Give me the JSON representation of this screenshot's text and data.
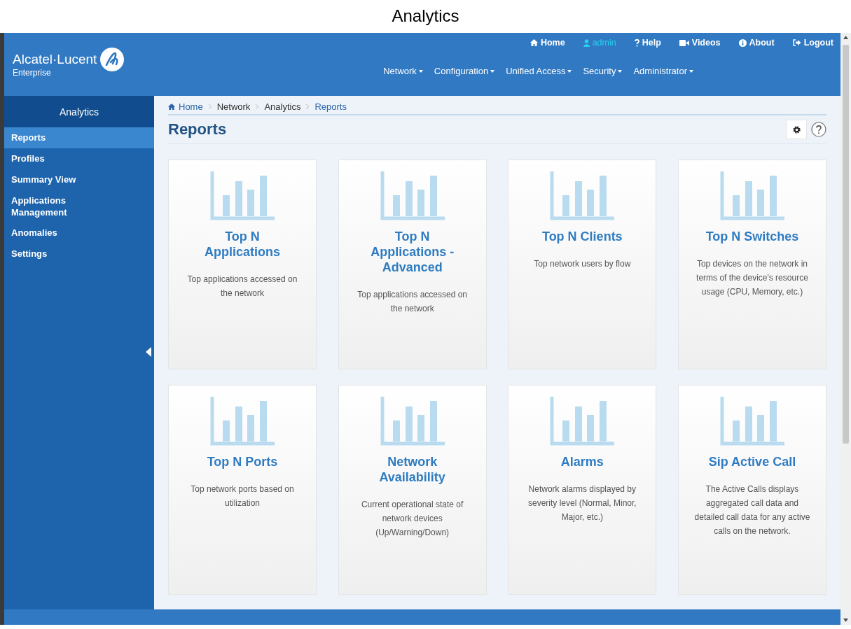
{
  "caption": "Analytics",
  "brand": {
    "name": "Alcatel·Lucent",
    "sub": "Enterprise"
  },
  "top_links": [
    {
      "label": "Home",
      "kind": "home"
    },
    {
      "label": "admin",
      "kind": "user"
    },
    {
      "label": "Help",
      "kind": "help"
    },
    {
      "label": "Videos",
      "kind": "video"
    },
    {
      "label": "About",
      "kind": "info"
    },
    {
      "label": "Logout",
      "kind": "logout"
    }
  ],
  "main_menu": [
    "Network",
    "Configuration",
    "Unified Access",
    "Security",
    "Administrator"
  ],
  "sidebar": {
    "title": "Analytics",
    "items": [
      {
        "label": "Reports",
        "selected": true
      },
      {
        "label": "Profiles",
        "selected": false
      },
      {
        "label": "Summary View",
        "selected": false
      },
      {
        "label": "Applications Management",
        "selected": false
      },
      {
        "label": "Anomalies",
        "selected": false
      },
      {
        "label": "Settings",
        "selected": false
      }
    ]
  },
  "breadcrumb": [
    "Home",
    "Network",
    "Analytics",
    "Reports"
  ],
  "page_title": "Reports",
  "cards": [
    {
      "title": "Top N Applications",
      "description": "Top applications accessed on the network"
    },
    {
      "title": "Top N Applications - Advanced",
      "description": "Top applications accessed on the network"
    },
    {
      "title": "Top N Clients",
      "description": "Top network users by flow"
    },
    {
      "title": "Top N Switches",
      "description": "Top devices on the network in terms of the device's resource usage (CPU, Memory, etc.)"
    },
    {
      "title": "Top N Ports",
      "description": "Top network ports based on utilization"
    },
    {
      "title": "Network Availability",
      "description": "Current operational state of network devices (Up/Warning/Down)"
    },
    {
      "title": "Alarms",
      "description": "Network alarms displayed by severity level (Normal, Minor, Major, etc.)"
    },
    {
      "title": "Sip Active Call",
      "description": "The Active Calls displays aggregated call data and detailed call data for any active calls on the network."
    }
  ]
}
